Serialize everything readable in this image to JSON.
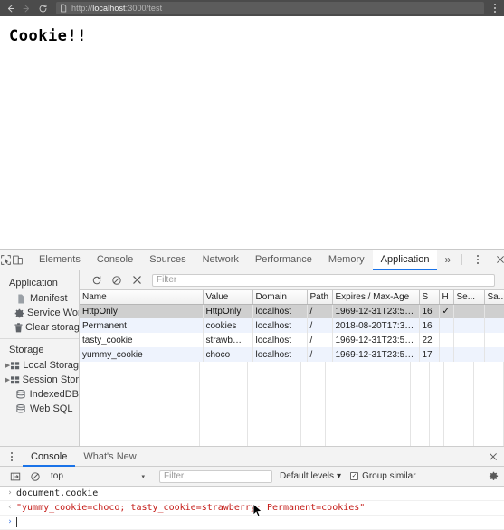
{
  "browser": {
    "back_icon": "back-arrow-icon",
    "forward_icon": "forward-arrow-icon",
    "reload_icon": "reload-icon",
    "page_icon": "document-icon",
    "url_scheme": "http://",
    "url_host": "localhost",
    "url_rest": ":3000/test",
    "url_full": "http://localhost:3000/test",
    "menu_icon": "three-dot-menu-icon"
  },
  "page": {
    "heading": "Cookie!!"
  },
  "devtools": {
    "inspect_icon": "inspect-element-icon",
    "device_icon": "device-toolbar-icon",
    "tabs": [
      {
        "label": "Elements",
        "active": false
      },
      {
        "label": "Console",
        "active": false
      },
      {
        "label": "Sources",
        "active": false
      },
      {
        "label": "Network",
        "active": false
      },
      {
        "label": "Performance",
        "active": false
      },
      {
        "label": "Memory",
        "active": false
      },
      {
        "label": "Application",
        "active": true
      }
    ],
    "more_tabs_label": "»",
    "settings_icon": "three-dot-menu-icon",
    "close_icon": "close-icon",
    "accent_color": "#1a73e8"
  },
  "sidebar": {
    "sections": [
      {
        "title": "Application",
        "items": [
          {
            "label": "Manifest",
            "icon": "manifest-file-icon",
            "expandable": false
          },
          {
            "label": "Service Work",
            "icon": "service-worker-gear-icon",
            "expandable": false
          },
          {
            "label": "Clear storage",
            "icon": "trash-icon",
            "expandable": false
          }
        ]
      },
      {
        "title": "Storage",
        "items": [
          {
            "label": "Local Storag",
            "icon": "storage-grid-icon",
            "expandable": true
          },
          {
            "label": "Session Stor",
            "icon": "storage-grid-icon",
            "expandable": true
          },
          {
            "label": "IndexedDB",
            "icon": "database-icon",
            "expandable": false
          },
          {
            "label": "Web SQL",
            "icon": "database-icon",
            "expandable": false
          }
        ]
      }
    ]
  },
  "cookie_toolbar": {
    "refresh_icon": "refresh-icon",
    "clear_icon": "clear-all-cookies-icon",
    "delete_icon": "delete-cookie-icon",
    "filter_placeholder": "Filter",
    "filter_value": ""
  },
  "cookie_table": {
    "columns": [
      "Name",
      "Value",
      "Domain",
      "Path",
      "Expires / Max-Age",
      "S",
      "H",
      "Se...",
      "Sa..."
    ],
    "rows": [
      {
        "selected": true,
        "cells": [
          "HttpOnly",
          "HttpOnly",
          "localhost",
          "/",
          "1969-12-31T23:5…",
          "16",
          "✓",
          "",
          ""
        ]
      },
      {
        "selected": false,
        "cells": [
          "Permanent",
          "cookies",
          "localhost",
          "/",
          "2018-08-20T17:3…",
          "16",
          "",
          "",
          ""
        ]
      },
      {
        "selected": false,
        "cells": [
          "tasty_cookie",
          "strawb…",
          "localhost",
          "/",
          "1969-12-31T23:5…",
          "22",
          "",
          "",
          ""
        ]
      },
      {
        "selected": false,
        "cells": [
          "yummy_cookie",
          "choco",
          "localhost",
          "/",
          "1969-12-31T23:5…",
          "17",
          "",
          "",
          ""
        ]
      }
    ]
  },
  "drawer": {
    "menu_icon": "three-dot-menu-icon",
    "tabs": [
      {
        "label": "Console",
        "active": true
      },
      {
        "label": "What's New",
        "active": false
      }
    ],
    "close_icon": "close-icon",
    "toolbar": {
      "sidebar_toggle_icon": "show-console-sidebar-icon",
      "clear_icon": "clear-console-icon",
      "context_value": "top",
      "context_caret": "▾",
      "filter_placeholder": "Filter",
      "filter_value": "",
      "levels_label": "Default levels",
      "levels_caret": "▾",
      "group_similar_label": "Group similar",
      "group_similar_checked": "✓",
      "settings_icon": "gear-icon"
    },
    "lines": [
      {
        "type": "input",
        "gutter": "›",
        "text": "document.cookie"
      },
      {
        "type": "result",
        "gutter": "‹",
        "text": "\"yummy_cookie=choco; tasty_cookie=strawberry; Permanent=cookies\""
      }
    ],
    "prompt_gutter": "›",
    "prompt_value": ""
  }
}
